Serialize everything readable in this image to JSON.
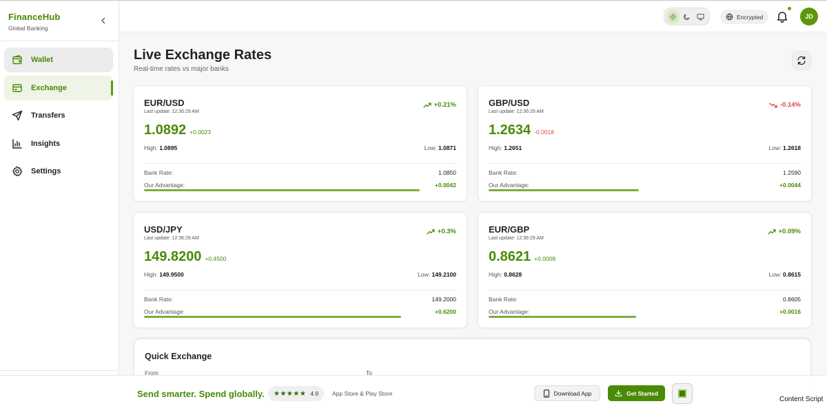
{
  "brand": {
    "name": "FinanceHub",
    "subtitle": "Global Banking"
  },
  "nav": [
    {
      "label": "Wallet",
      "icon": "wallet-icon"
    },
    {
      "label": "Exchange",
      "icon": "exchange-icon",
      "active": true
    },
    {
      "label": "Transfers",
      "icon": "send-icon"
    },
    {
      "label": "Insights",
      "icon": "bar-chart-icon"
    },
    {
      "label": "Settings",
      "icon": "gear-icon"
    }
  ],
  "header": {
    "theme_options": [
      "sun-icon",
      "moon-icon",
      "monitor-icon"
    ],
    "encrypted_label": "Encrypted",
    "avatar_initials": "JD"
  },
  "page": {
    "title": "Live Exchange Rates",
    "subtitle": "Real-time rates vs major banks"
  },
  "rates": [
    {
      "pair": "EUR/USD",
      "updated": "Last update: 12:36:29 AM",
      "change": "+0.21%",
      "direction": "up",
      "rate": "1.0892",
      "delta": "+0.0023",
      "high_label": "High:",
      "high": "1.0895",
      "low_label": "Low:",
      "low": "1.0871",
      "bank_label": "Bank Rate:",
      "bank_rate": "1.0850",
      "advantage_label": "Our Advantage:",
      "advantage": "+0.0042",
      "advantage_fill": 0.88
    },
    {
      "pair": "GBP/USD",
      "updated": "Last update: 12:36:29 AM",
      "change": "-0.14%",
      "direction": "down",
      "rate": "1.2634",
      "delta": "-0.0018",
      "high_label": "High:",
      "high": "1.2651",
      "low_label": "Low:",
      "low": "1.2618",
      "bank_label": "Bank Rate:",
      "bank_rate": "1.2590",
      "advantage_label": "Our Advantage:",
      "advantage": "+0.0044",
      "advantage_fill": 0.48
    },
    {
      "pair": "USD/JPY",
      "updated": "Last update: 12:36:29 AM",
      "change": "+0.3%",
      "direction": "up",
      "rate": "149.8200",
      "delta": "+0.4500",
      "high_label": "High:",
      "high": "149.9500",
      "low_label": "Low:",
      "low": "149.2100",
      "bank_label": "Bank Rate:",
      "bank_rate": "149.2000",
      "advantage_label": "Our Advantage:",
      "advantage": "+0.6200",
      "advantage_fill": 0.82
    },
    {
      "pair": "EUR/GBP",
      "updated": "Last update: 12:36:29 AM",
      "change": "+0.09%",
      "direction": "up",
      "rate": "0.8621",
      "delta": "+0.0008",
      "high_label": "High:",
      "high": "0.8628",
      "low_label": "Low:",
      "low": "0.8615",
      "bank_label": "Bank Rate:",
      "bank_rate": "0.8605",
      "advantage_label": "Our Advantage:",
      "advantage": "+0.0016",
      "advantage_fill": 0.47
    }
  ],
  "quick_exchange": {
    "title": "Quick Exchange",
    "from_label": "From",
    "to_label": "To"
  },
  "banner": {
    "tagline": "Send smarter. Spend globally.",
    "stars": "★★★★★",
    "rating": "4.9",
    "stores": "App Store & Play Store",
    "download_label": "Download App",
    "get_started_label": "Get Started"
  },
  "content_script_label": "Content Script",
  "colors": {
    "accent": "#4a8a06",
    "up": "#4a8a06",
    "down": "#e04646"
  }
}
